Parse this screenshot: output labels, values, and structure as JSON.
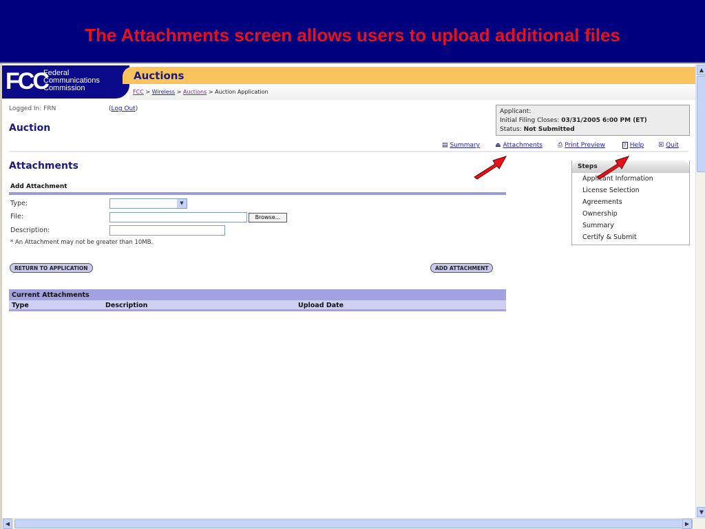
{
  "slide_title": "The Attachments screen allows users to upload additional files",
  "logo": {
    "letters": "FCC",
    "line1": "Federal",
    "line2": "Communications",
    "line3": "Commission"
  },
  "header": {
    "section": "Auctions"
  },
  "breadcrumb": [
    {
      "label": "FCC"
    },
    {
      "label": "Wireless"
    },
    {
      "label": "Auctions"
    },
    {
      "label": "Auction Application"
    }
  ],
  "breadcrumb_sep": ">",
  "login": {
    "label": "Logged In: FRN",
    "logout": "Log Out"
  },
  "page_heading": "Auction",
  "info": {
    "applicant": "Applicant:",
    "closes_label": "Initial Filing Closes:",
    "closes_value": "03/31/2005 6:00 PM (ET)",
    "status_label": "Status:",
    "status_value": "Not Submitted"
  },
  "toolbar": [
    {
      "icon": "summary-icon",
      "glyph": "▤",
      "label": "Summary"
    },
    {
      "icon": "upload-icon",
      "glyph": "⏏",
      "label": "Attachments"
    },
    {
      "icon": "print-icon",
      "glyph": "⎙",
      "label": "Print Preview"
    },
    {
      "icon": "help-icon",
      "glyph": "?",
      "label": "Help"
    },
    {
      "icon": "quit-icon",
      "glyph": "☒",
      "label": "Quit"
    }
  ],
  "attachments": {
    "title": "Attachments",
    "section": "Add Attachment",
    "type_label": "Type:",
    "type_value": "",
    "file_label": "File:",
    "file_value": "",
    "browse": "Browse...",
    "desc_label": "Description:",
    "desc_value": "",
    "note": "* An Attachment may not be greater than 10MB.",
    "return_btn": "RETURN TO APPLICATION",
    "add_btn": "ADD ATTACHMENT"
  },
  "current": {
    "title": "Current Attachments",
    "columns": [
      "Type",
      "Description",
      "Upload Date"
    ]
  },
  "steps": {
    "title": "Steps",
    "items": [
      "Applicant Information",
      "License Selection",
      "Agreements",
      "Ownership",
      "Summary",
      "Certify & Submit"
    ]
  },
  "colors": {
    "banner": "#00007f",
    "title_red": "#e8101a",
    "orange": "#f9c45c",
    "navy": "#1a1a80",
    "lavender": "#a2a2e0",
    "arrow": "#e8101a"
  }
}
